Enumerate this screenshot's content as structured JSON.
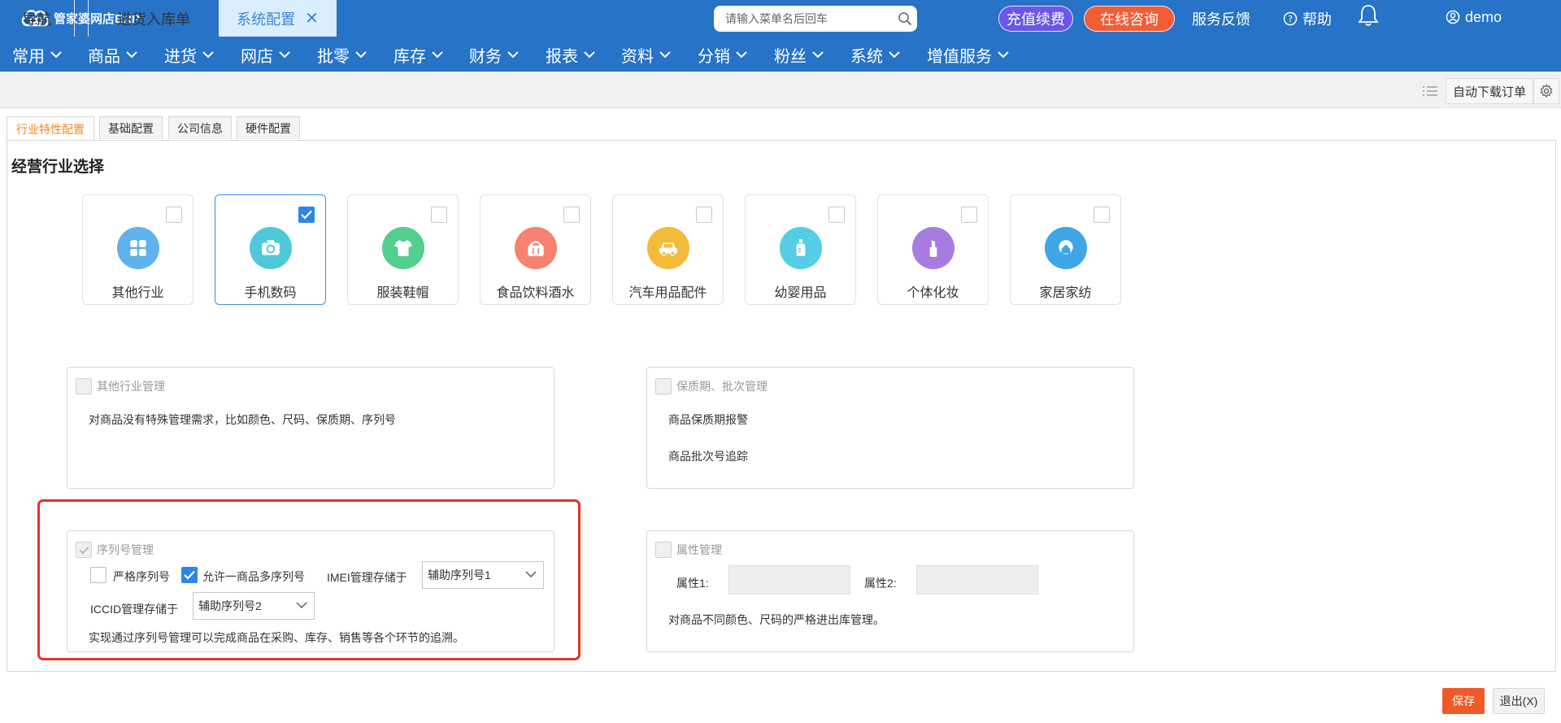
{
  "header": {
    "logo_text": "管家婆网店ERP",
    "search_placeholder": "请输入菜单名后回车",
    "recharge_label": "充值续费",
    "consult_label": "在线咨询",
    "feedback_label": "服务反馈",
    "help_label": "帮助",
    "user_label": "demo",
    "colors": {
      "bar": "#2673c7",
      "recharge": "#6a57e8",
      "consult": "#f25d36"
    }
  },
  "menu": [
    "常用",
    "商品",
    "进货",
    "网店",
    "批零",
    "库存",
    "财务",
    "报表",
    "资料",
    "分销",
    "粉丝",
    "系统",
    "增值服务"
  ],
  "tabs": [
    {
      "label": "导航"
    },
    {
      "label": "进货入库单"
    },
    {
      "label": "系统配置",
      "close": "✕"
    }
  ],
  "toolbar": {
    "auto_download_label": "自动下载订单"
  },
  "subtabs": [
    "行业特性配置",
    "基础配置",
    "公司信息",
    "硬件配置"
  ],
  "section_title": "经营行业选择",
  "industries": [
    {
      "label": "其他行业",
      "icon": "grid-icon",
      "color": "#5fb2ec",
      "checked": false
    },
    {
      "label": "手机数码",
      "icon": "camera-icon",
      "color": "#4ec9d8",
      "checked": true
    },
    {
      "label": "服装鞋帽",
      "icon": "shirt-icon",
      "color": "#52cf8e",
      "checked": false
    },
    {
      "label": "食品饮料酒水",
      "icon": "basket-icon",
      "color": "#f6826f",
      "checked": false
    },
    {
      "label": "汽车用品配件",
      "icon": "car-icon",
      "color": "#f5bb3b",
      "checked": false
    },
    {
      "label": "幼婴用品",
      "icon": "bottle-icon",
      "color": "#55cde6",
      "checked": false
    },
    {
      "label": "个体化妆",
      "icon": "lipstick-icon",
      "color": "#a77ce0",
      "checked": false
    },
    {
      "label": "家居家纺",
      "icon": "home-icon",
      "color": "#3ea6e6",
      "checked": false
    }
  ],
  "config": {
    "other": {
      "title": "其他行业管理",
      "desc": "对商品没有特殊管理需求，比如颜色、尺码、保质期、序列号"
    },
    "shelf": {
      "title": "保质期、批次管理",
      "line1": "商品保质期报警",
      "line2": "商品批次号追踪"
    },
    "serial": {
      "title": "序列号管理",
      "strict_label": "严格序列号",
      "strict_checked": false,
      "multi_label": "允许一商品多序列号",
      "multi_checked": true,
      "imei_label": "IMEI管理存储于",
      "imei_value": "辅助序列号1",
      "iccid_label": "ICCID管理存储于",
      "iccid_value": "辅助序列号2",
      "desc": "实现通过序列号管理可以完成商品在采购、库存、销售等各个环节的追溯。"
    },
    "attr": {
      "title": "属性管理",
      "attr1_label": "属性1:",
      "attr2_label": "属性2:",
      "desc": "对商品不同颜色、尺码的严格进出库管理。"
    }
  },
  "footer": {
    "save_label": "保存",
    "exit_label": "退出(X)"
  }
}
